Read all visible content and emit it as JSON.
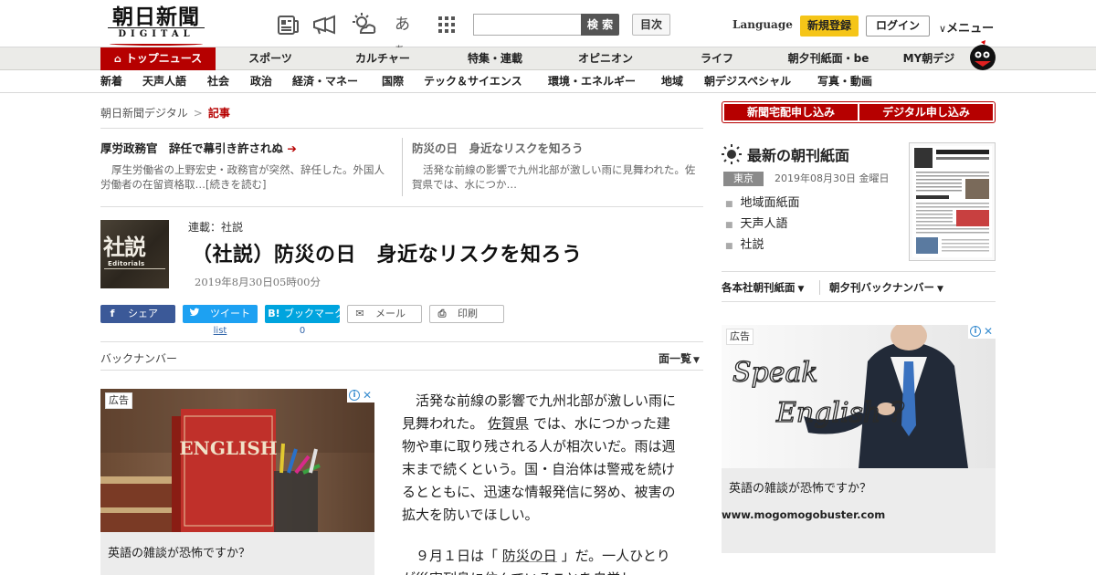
{
  "header": {
    "logo_jp": "朝日新聞",
    "logo_en": "DIGITAL",
    "font_toggle": {
      "big": "あ",
      "small": "あ"
    },
    "search_placeholder": "",
    "search_button": "検 索",
    "contents_button": "目次",
    "language": "Language",
    "register_button": "新規登録",
    "login_button": "ログイン",
    "menu_button": "メニュー",
    "icons": [
      "newspaper-icon",
      "megaphone-icon",
      "weather-icon",
      "font-size-icon",
      "grid-menu-icon",
      "chevron-down-icon"
    ]
  },
  "nav_primary": [
    {
      "label": "トップニュース",
      "active": true
    },
    {
      "label": "スポーツ"
    },
    {
      "label": "カルチャー"
    },
    {
      "label": "特集・連載"
    },
    {
      "label": "オピニオン"
    },
    {
      "label": "ライフ"
    },
    {
      "label": "朝夕刊紙面・be"
    },
    {
      "label": "MY朝デジ"
    }
  ],
  "nav_secondary": [
    "新着",
    "天声人語",
    "社会",
    "政治",
    "経済・マネー",
    "国際",
    "テック＆サイエンス",
    "環境・エネルギー",
    "地域",
    "朝デジスペシャル",
    "写真・動画"
  ],
  "breadcrumb": {
    "home": "朝日新聞デジタル",
    "sep": ">",
    "current": "記事"
  },
  "related": [
    {
      "title": "厚労政務官　辞任で幕引き許されぬ",
      "arrow": "➔",
      "summary": "厚生労働省の上野宏史・政務官が突然、辞任した。外国人労働者の在留資格取…[続きを読む]"
    },
    {
      "title": "防災の日　身近なリスクを知ろう",
      "summary": "活発な前線の影響で九州北部が激しい雨に見舞われた。佐賀県では、水につか…"
    }
  ],
  "article": {
    "thumb_text": "社説",
    "thumb_sub": "Editorials",
    "series": "連載：社説",
    "title": "（社説）防災の日　身近なリスクを知ろう",
    "date": "2019年8月30日05時00分",
    "share": [
      {
        "label": "シェア",
        "icon": "f"
      },
      {
        "label": "ツイート",
        "icon": "t"
      },
      {
        "label": "ブックマーク",
        "icon": "B!"
      },
      {
        "label": "メール",
        "icon": "✉"
      },
      {
        "label": "印刷",
        "icon": "⎙"
      }
    ],
    "tweet_count": "list",
    "bookmark_count": "0",
    "backnumber": "バックナンバー",
    "page_list": "面一覧",
    "body": [
      {
        "a": "活発な前線の影響で九州北部が激しい雨に見舞われた。",
        "link": "佐賀県",
        "b": "では、水につかった建物や車に取り残される人が相次いだ。雨は週末まで続くという。国・自治体は警戒を続けるとともに、迅速な情報発信に努め、被害の拡大を防いでほしい。"
      },
      {
        "a": "９月１日は「",
        "link": "防災の日",
        "b": "」だ。一人ひとりが災害列島に住んでいることを自覚し、"
      }
    ]
  },
  "ad_left": {
    "tag": "広告",
    "book_title": "ENGLISH",
    "copy": "英語の雑談が恐怖ですか？"
  },
  "ad_right": {
    "tag": "広告",
    "board_text_1": "Speak",
    "board_text_2": "English ?",
    "copy": "英語の雑談が恐怖ですか？",
    "url": "www.mogomogobuster.com"
  },
  "sidebar": {
    "subscribe_1": "新聞宅配申し込み",
    "subscribe_2": "デジタル申し込み",
    "paper_title": "最新の朝刊紙面",
    "edition": "東京",
    "edition_date": "2019年08月30日 金曜日",
    "paper_links": [
      "地域面紙面",
      "天声人語",
      "社説"
    ],
    "backnumbers": [
      "各本社朝刊紙面",
      "朝夕刊バックナンバー"
    ]
  },
  "colors": {
    "brand_red": "#b60000",
    "accent_yellow": "#f5c518",
    "facebook": "#3b5998",
    "twitter": "#1da1f2",
    "hatena": "#00a4de"
  }
}
